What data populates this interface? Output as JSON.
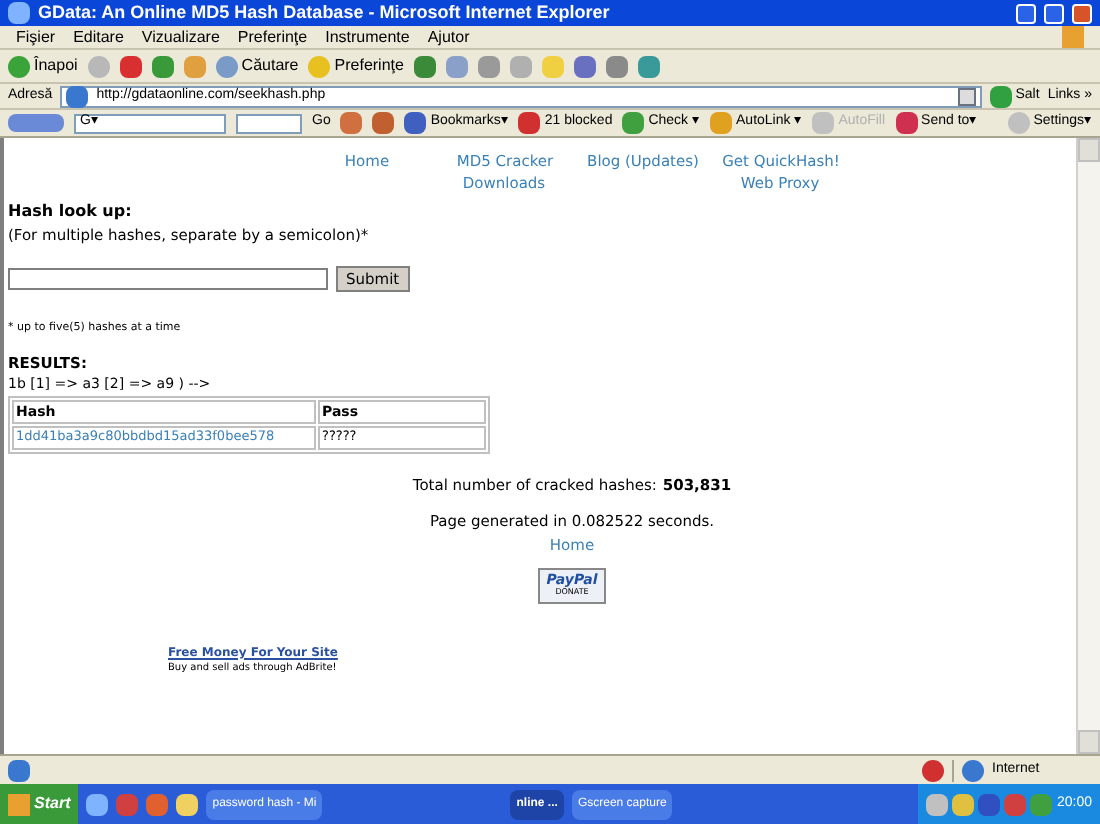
{
  "window": {
    "title": "GData: An Online MD5 Hash Database - Microsoft Internet Explorer"
  },
  "menu": [
    "Fişier",
    "Editare",
    "Vizualizare",
    "Preferinţe",
    "Instrumente",
    "Ajutor"
  ],
  "toolbar": {
    "back": "Înapoi",
    "search": "Căutare",
    "favorites": "Preferinţe"
  },
  "address_bar": {
    "label": "Adresă",
    "url": "http://gdataonline.com/seekhash.php",
    "go": "Salt",
    "links": "Links »"
  },
  "google_toolbar": {
    "search_menu": "G▾",
    "go": "Go",
    "bookmarks": "Bookmarks▾",
    "blocked": "21 blocked",
    "check": "Check ▾",
    "autolink": "AutoLink ▾",
    "autofill": "AutoFill",
    "send_to": "Send to▾",
    "settings": "Settings▾"
  },
  "nav": {
    "row_1": [
      "Home",
      "MD5 Cracker",
      "Blog (Updates)",
      "Get QuickHash!"
    ],
    "row_2": [
      "Downloads",
      "Web Proxy"
    ]
  },
  "form": {
    "heading": "Hash look up:",
    "hint": "(For multiple hashes, separate by a semicolon)*",
    "submit": "Submit",
    "note": "* up to five(5) hashes at a time"
  },
  "results": {
    "heading": "RESULTS:",
    "debug": "1b [1] => a3 [2] => a9 ) -->",
    "columns": [
      "Hash",
      "Pass"
    ],
    "rows": [
      {
        "hash": "1dd41ba3a9c80bbdbd15ad33f0bee578",
        "pass": "?????"
      }
    ]
  },
  "stats": {
    "label": "Total number of cracked hashes:",
    "count": "503,831",
    "generated": "Page generated in 0.082522 seconds.",
    "home": "Home"
  },
  "donate": {
    "logo": "PayPal",
    "caption": "DONATE"
  },
  "ad": {
    "link": "Free Money For Your Site",
    "text": "Buy and sell ads through AdBrite!"
  },
  "status_bar": {
    "zone": "Internet"
  },
  "taskbar": {
    "start": "Start",
    "tasks": [
      {
        "label": "password hash - Mi",
        "selected": false
      },
      {
        "label": "nline ...",
        "selected": true
      },
      {
        "label": "Gscreen capture",
        "selected": false
      }
    ],
    "clock": "20:00"
  }
}
